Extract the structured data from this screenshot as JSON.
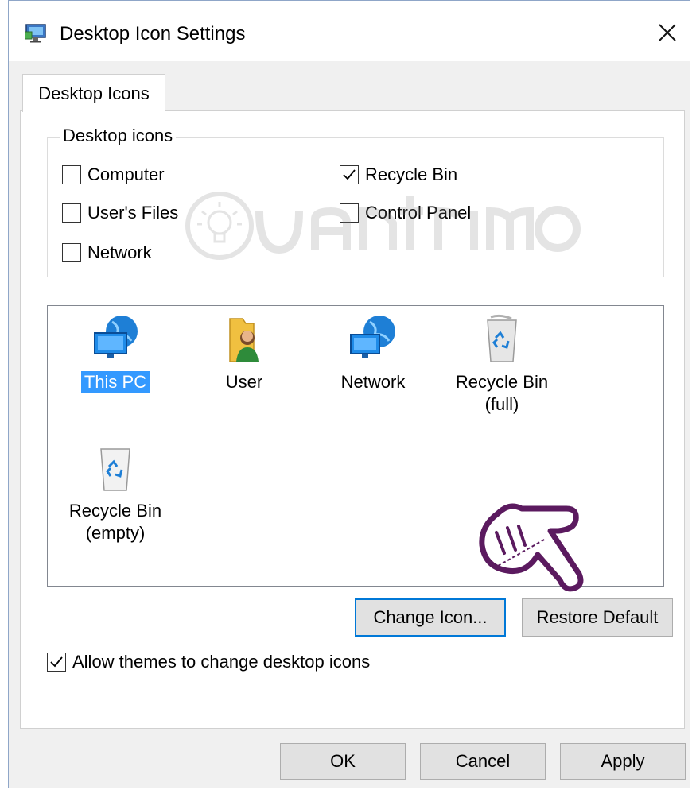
{
  "window": {
    "title": "Desktop Icon Settings",
    "app_icon": "display-settings-icon",
    "close_icon": "close-icon"
  },
  "tab": {
    "label": "Desktop Icons"
  },
  "group": {
    "label": "Desktop icons",
    "checkboxes": [
      {
        "label": "Computer",
        "checked": false
      },
      {
        "label": "User's Files",
        "checked": false
      },
      {
        "label": "Network",
        "checked": false
      },
      {
        "label": "Recycle Bin",
        "checked": true
      },
      {
        "label": "Control Panel",
        "checked": false
      }
    ]
  },
  "icons": [
    {
      "label": "This PC",
      "icon": "this-pc-icon",
      "selected": true
    },
    {
      "label": "User",
      "icon": "user-folder-icon",
      "selected": false
    },
    {
      "label": "Network",
      "icon": "network-icon",
      "selected": false
    },
    {
      "label": "Recycle Bin (full)",
      "line1": "Recycle Bin",
      "line2": "(full)",
      "icon": "recycle-bin-full-icon",
      "selected": false
    },
    {
      "label": "Recycle Bin (empty)",
      "line1": "Recycle Bin",
      "line2": "(empty)",
      "icon": "recycle-bin-empty-icon",
      "selected": false
    }
  ],
  "buttons": {
    "change_icon": "Change Icon...",
    "restore_default": "Restore Default",
    "ok": "OK",
    "cancel": "Cancel",
    "apply": "Apply"
  },
  "allow_themes": {
    "label": "Allow themes to change desktop icons",
    "checked": true
  },
  "colors": {
    "accent": "#0078d7",
    "selection": "#3399ff",
    "annotation": "#5b1a5f"
  },
  "annotation": "pointing-hand-icon"
}
